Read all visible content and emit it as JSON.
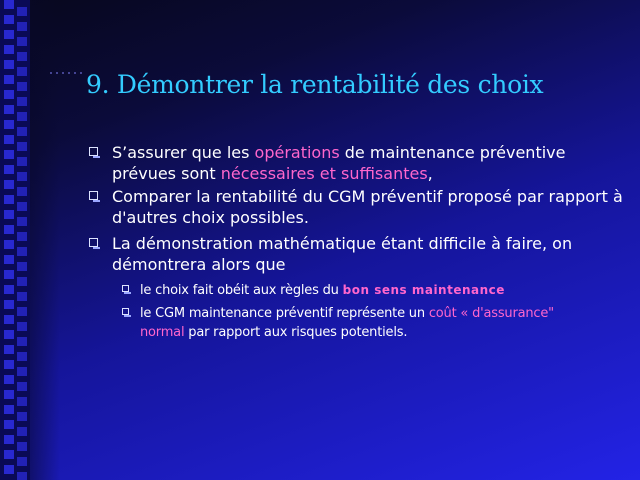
{
  "slide": {
    "title": "9. Démontrer la rentabilité des choix",
    "bullets": [
      {
        "parts": [
          {
            "text": "S’assurer que les ",
            "style": "normal"
          },
          {
            "text": "opérations",
            "style": "pink"
          },
          {
            "text": " de maintenance préventive prévues sont ",
            "style": "normal"
          },
          {
            "text": "nécessaires et suffisantes",
            "style": "pink"
          },
          {
            "text": ",",
            "style": "normal"
          }
        ]
      },
      {
        "parts": [
          {
            "text": "Comparer la rentabilité du CGM préventif proposé par rapport à d'autres choix possibles.",
            "style": "normal"
          }
        ]
      },
      {
        "parts": [
          {
            "text": "La démonstration mathématique étant difficile à faire, on démontrera alors que",
            "style": "normal"
          }
        ],
        "sub": [
          {
            "parts": [
              {
                "text": "le choix fait obéit aux règles du ",
                "style": "normal"
              },
              {
                "text": "bon sens maintenance",
                "style": "pink-bold"
              }
            ]
          },
          {
            "parts": [
              {
                "text": "le CGM maintenance préventif représente un ",
                "style": "normal"
              },
              {
                "text": "coût « d'assurance\" normal",
                "style": "pink"
              },
              {
                "text": " par rapport aux risques potentiels.",
                "style": "normal"
              }
            ]
          }
        ]
      }
    ]
  },
  "colors": {
    "title": "#33ccff",
    "text": "#ffffff",
    "highlight": "#ff66cc",
    "bullet": "#dde3ff"
  },
  "icons": {
    "bullet": "square-bullet-icon",
    "decoration": "square-pattern"
  }
}
